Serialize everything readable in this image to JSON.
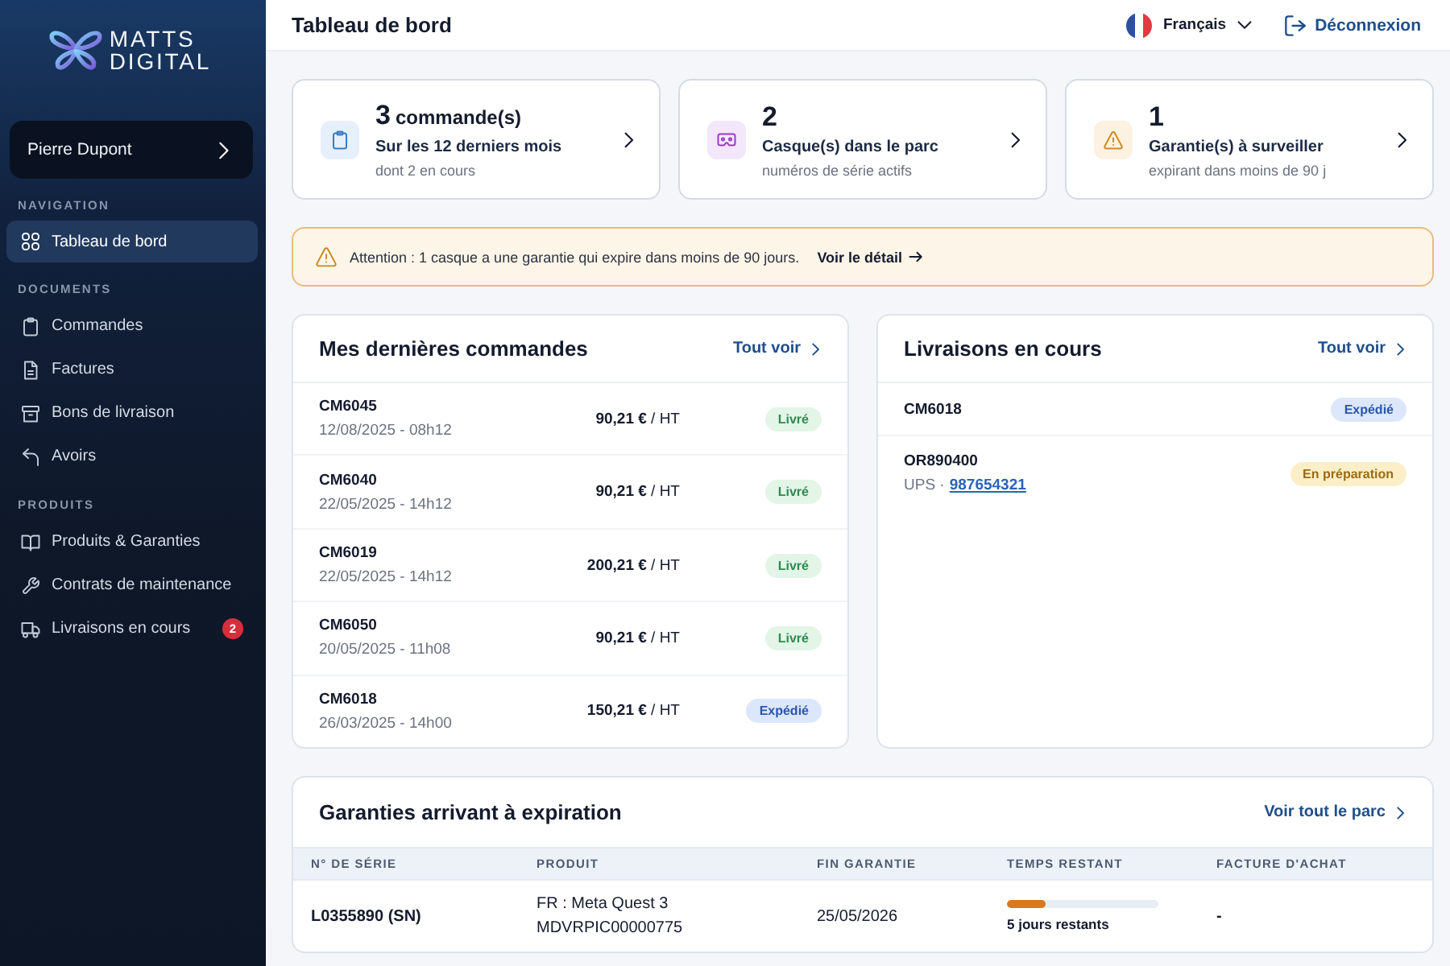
{
  "sidebar": {
    "logo": {
      "lines": [
        "MATTS",
        "DIGITAL"
      ]
    },
    "user": {
      "name": "Pierre Dupont"
    },
    "sections": [
      {
        "title": "NAVIGATION",
        "items": [
          {
            "label": "Tableau de bord",
            "kind": "grid",
            "selected": true
          }
        ]
      },
      {
        "title": "DOCUMENTS",
        "items": [
          {
            "label": "Commandes",
            "kind": "clipboard",
            "selected": false
          },
          {
            "label": "Factures",
            "kind": "document",
            "selected": false
          },
          {
            "label": "Bons de livraison",
            "kind": "archive",
            "selected": false
          },
          {
            "label": "Avoirs",
            "kind": "undo",
            "selected": false
          }
        ]
      },
      {
        "title": "PRODUITS",
        "items": [
          {
            "label": "Produits & Garanties",
            "kind": "book",
            "selected": false
          },
          {
            "label": "Contrats de maintenance",
            "kind": "wrench",
            "selected": false
          },
          {
            "label": "Livraisons en cours",
            "kind": "truck",
            "selected": false,
            "badge": "2"
          }
        ]
      }
    ]
  },
  "topbar": {
    "title": "Tableau de bord",
    "language": "Français",
    "logout": "Déconnexion"
  },
  "stats": [
    {
      "kind": "clipboard",
      "value": "3",
      "unit": "commande(s)",
      "title": "Sur les 12 derniers mois",
      "subtitle": "dont 2 en cours"
    },
    {
      "kind": "headset",
      "value": "2",
      "title": "Casque(s) dans le parc",
      "subtitle": "numéros de série actifs"
    },
    {
      "kind": "warning",
      "value": "1",
      "title": "Garantie(s) à surveiller",
      "subtitle": "expirant dans moins de 90 j"
    }
  ],
  "alert": {
    "message": "Attention : 1 casque a une garantie qui expire dans moins de 90 jours.",
    "link": "Voir le détail"
  },
  "orders": {
    "title": "Mes dernières commandes",
    "link": "Tout voir",
    "rows": [
      {
        "code": "CM6045",
        "date": "12/08/2025 - 08h12",
        "price": "**90,21 €** / HT",
        "status": {
          "kind": "delivered",
          "label": "Livré"
        }
      },
      {
        "code": "CM6040",
        "date": "22/05/2025 - 14h12",
        "price": "**90,21 €** / HT",
        "status": {
          "kind": "delivered",
          "label": "Livré"
        }
      },
      {
        "code": "CM6019",
        "date": "22/05/2025 - 14h12",
        "price": "**200,21 €** / HT",
        "status": {
          "kind": "delivered",
          "label": "Livré"
        }
      },
      {
        "code": "CM6050",
        "date": "20/05/2025 - 11h08",
        "price": "**90,21 €** / HT",
        "status": {
          "kind": "delivered",
          "label": "Livré"
        }
      },
      {
        "code": "CM6018",
        "date": "26/03/2025 - 14h00",
        "price": "**150,21 €** / HT",
        "status": {
          "kind": "shipped",
          "label": "Expédié"
        }
      }
    ]
  },
  "deliveries": {
    "title": "Livraisons en cours",
    "link": "Tout voir",
    "rows": [
      {
        "code": "CM6018",
        "status": {
          "kind": "shipped",
          "label": "Expédié"
        }
      },
      {
        "code": "OR890400",
        "carrier": "UPS ·",
        "tracking": "987654321",
        "status": {
          "kind": "preparing",
          "label": "En préparation"
        }
      }
    ]
  },
  "warranties": {
    "title": "Garanties arrivant à expiration",
    "link": "Voir tout le parc",
    "columns": [
      "N° DE SÉRIE",
      "PRODUIT",
      "FIN GARANTIE",
      "TEMPS RESTANT",
      "FACTURE D'ACHAT"
    ],
    "rows": [
      {
        "serial": "L0355890 (SN)",
        "product": "FR : Meta Quest 3",
        "reference": "MDVRPIC00000775",
        "end_date": "25/05/2026",
        "remaining": {
          "level": 0.26,
          "label": "5 jours restants"
        },
        "invoice": "-"
      }
    ]
  }
}
